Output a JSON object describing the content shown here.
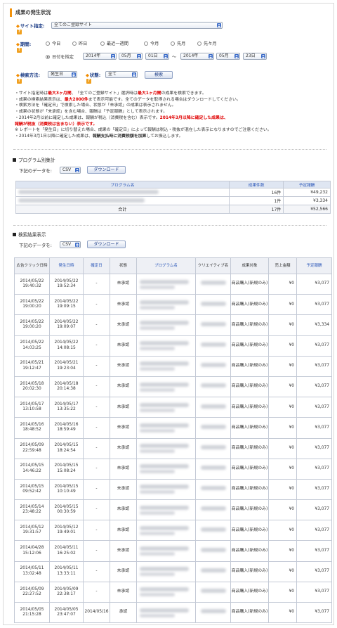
{
  "title": "成果の発生状況",
  "site": {
    "label": "サイト指定:",
    "value": "全てのご登録サイト"
  },
  "period": {
    "label": "期間:",
    "options": [
      "今日",
      "昨日",
      "最近一週間",
      "今月",
      "先月",
      "先々月"
    ],
    "date_option": "日付を指定",
    "from": {
      "year": "2014年",
      "month": "05月",
      "day": "01日"
    },
    "tilde": "〜",
    "to": {
      "year": "2014年",
      "month": "05月",
      "day": "23日"
    }
  },
  "search_method": {
    "label": "検索方法:",
    "value": "発生日"
  },
  "status": {
    "label": "状態:",
    "value": "全て"
  },
  "search_button": "検索",
  "notes": {
    "n1": [
      "・サイト指定時は",
      "最大3ヶ月間",
      "、「全てのご登録サイト」選択時は",
      "最大1ヶ月間",
      "の成果を検索できます。"
    ],
    "n2": [
      "・成果の検索結果表示は、",
      "最大2000件",
      "まで表示可能です。全てのデータを取得される場合はダウンロードしてください。"
    ],
    "n3": "・検索方法を「確定日」で検索した場合、状態が「未承認」の成果は表示されません。",
    "n4": "・成果の状態が「未承認」を含む場合、報酬は「予定報酬」として表示されます。",
    "n5": [
      "・2014年2月以前に確定した成果は、報酬が税込（消費税を含む）表示です。",
      "2014年3月以降に確定した成果は、"
    ],
    "n6": "報酬が税抜（消費税は含まない）表示です。",
    "n7": "※ レポートを「発生日」に切り替えた場合、成果の「確定日」によって報酬は税込・税抜が混在した表示になりますのでご注意ください。",
    "n8": [
      "・2014年3月1日以降に確定した成果は、",
      "報酬支払時に消費税額を加算",
      "してお振込します。"
    ]
  },
  "program_summary": {
    "heading": "プログラム別集計",
    "download_label": "下記のデータを:",
    "format": "CSV",
    "download_button": "ダウンロード",
    "columns": [
      "プログラム名",
      "成果件数",
      "予定報酬"
    ],
    "rows": [
      {
        "count": "16件",
        "reward": "¥49,232"
      },
      {
        "count": "1件",
        "reward": "¥3,334"
      }
    ],
    "total": {
      "label": "合計",
      "count": "17件",
      "reward": "¥52,566"
    }
  },
  "results": {
    "heading": "検索結果表示",
    "download_label": "下記のデータを:",
    "format": "CSV",
    "download_button": "ダウンロード",
    "columns": [
      "広告クリック日時",
      "発生日時",
      "確定日",
      "状態",
      "プログラム名",
      "クリエイティブ名",
      "成果対象",
      "売上金額",
      "予定報酬"
    ],
    "rows": [
      {
        "click": [
          "2014/05/22",
          "19:40:32"
        ],
        "occur": [
          "2014/05/22",
          "19:52:34"
        ],
        "confirm": "-",
        "status": "未承認",
        "target": "商品購入(新規のみ)",
        "sales": "¥0",
        "reward": "¥3,077"
      },
      {
        "click": [
          "2014/05/22",
          "19:00:20"
        ],
        "occur": [
          "2014/05/22",
          "19:09:15"
        ],
        "confirm": "-",
        "status": "未承認",
        "target": "商品購入(新規のみ)",
        "sales": "¥0",
        "reward": "¥3,077"
      },
      {
        "click": [
          "2014/05/22",
          "19:00:20"
        ],
        "occur": [
          "2014/05/22",
          "19:09:07"
        ],
        "confirm": "-",
        "status": "未承認",
        "target": "商品購入(新規のみ)",
        "sales": "¥0",
        "reward": "¥3,334"
      },
      {
        "click": [
          "2014/05/22",
          "14:03:25"
        ],
        "occur": [
          "2014/05/22",
          "14:08:15"
        ],
        "confirm": "-",
        "status": "未承認",
        "target": "商品購入(新規のみ)",
        "sales": "¥0",
        "reward": "¥3,077"
      },
      {
        "click": [
          "2014/05/21",
          "19:12:47"
        ],
        "occur": [
          "2014/05/21",
          "19:23:04"
        ],
        "confirm": "-",
        "status": "未承認",
        "target": "商品購入(新規のみ)",
        "sales": "¥0",
        "reward": "¥3,077"
      },
      {
        "click": [
          "2014/05/18",
          "20:02:30"
        ],
        "occur": [
          "2014/05/18",
          "20:14:38"
        ],
        "confirm": "-",
        "status": "未承認",
        "target": "商品購入(新規のみ)",
        "sales": "¥0",
        "reward": "¥3,077"
      },
      {
        "click": [
          "2014/05/17",
          "13:10:58"
        ],
        "occur": [
          "2014/05/17",
          "13:35:22"
        ],
        "confirm": "-",
        "status": "未承認",
        "target": "商品購入(新規のみ)",
        "sales": "¥0",
        "reward": "¥3,077"
      },
      {
        "click": [
          "2014/05/16",
          "18:48:52"
        ],
        "occur": [
          "2014/05/16",
          "18:59:49"
        ],
        "confirm": "-",
        "status": "未承認",
        "target": "商品購入(新規のみ)",
        "sales": "¥0",
        "reward": "¥3,077"
      },
      {
        "click": [
          "2014/05/09",
          "22:59:48"
        ],
        "occur": [
          "2014/05/15",
          "18:24:54"
        ],
        "confirm": "-",
        "status": "未承認",
        "target": "商品購入(新規のみ)",
        "sales": "¥0",
        "reward": "¥3,077"
      },
      {
        "click": [
          "2014/05/15",
          "14:46:22"
        ],
        "occur": [
          "2014/05/15",
          "15:08:24"
        ],
        "confirm": "-",
        "status": "未承認",
        "target": "商品購入(新規のみ)",
        "sales": "¥0",
        "reward": "¥3,077"
      },
      {
        "click": [
          "2014/05/15",
          "09:52:42"
        ],
        "occur": [
          "2014/05/15",
          "10:10:49"
        ],
        "confirm": "-",
        "status": "未承認",
        "target": "商品購入(新規のみ)",
        "sales": "¥0",
        "reward": "¥3,077"
      },
      {
        "click": [
          "2014/05/14",
          "23:48:22"
        ],
        "occur": [
          "2014/05/15",
          "00:30:59"
        ],
        "confirm": "-",
        "status": "未承認",
        "target": "商品購入(新規のみ)",
        "sales": "¥0",
        "reward": "¥3,077"
      },
      {
        "click": [
          "2014/05/12",
          "19:31:57"
        ],
        "occur": [
          "2014/05/12",
          "19:49:01"
        ],
        "confirm": "-",
        "status": "未承認",
        "target": "商品購入(新規のみ)",
        "sales": "¥0",
        "reward": "¥3,077"
      },
      {
        "click": [
          "2014/04/28",
          "15:12:06"
        ],
        "occur": [
          "2014/05/11",
          "16:25:02"
        ],
        "confirm": "-",
        "status": "未承認",
        "target": "商品購入(新規のみ)",
        "sales": "¥0",
        "reward": "¥3,077"
      },
      {
        "click": [
          "2014/05/11",
          "13:02:48"
        ],
        "occur": [
          "2014/05/11",
          "13:33:11"
        ],
        "confirm": "-",
        "status": "未承認",
        "target": "商品購入(新規のみ)",
        "sales": "¥0",
        "reward": "¥3,077"
      },
      {
        "click": [
          "2014/05/09",
          "22:27:52"
        ],
        "occur": [
          "2014/05/09",
          "22:38:17"
        ],
        "confirm": "-",
        "status": "未承認",
        "target": "商品購入(新規のみ)",
        "sales": "¥0",
        "reward": "¥3,077"
      },
      {
        "click": [
          "2014/05/05",
          "21:15:28"
        ],
        "occur": [
          "2014/05/05",
          "23:47:07"
        ],
        "confirm": "2014/05/16",
        "status": "承認",
        "target": "商品購入(新規のみ)",
        "sales": "¥0",
        "reward": "¥3,077"
      }
    ]
  },
  "colors": {
    "accent": "#f2920c",
    "link": "#2a56b8",
    "label": "#1a3b85",
    "red": "#e00000"
  },
  "icons": {
    "help": "question-icon",
    "dropdown": "select-arrow-icon",
    "radio": "radio-icon"
  }
}
